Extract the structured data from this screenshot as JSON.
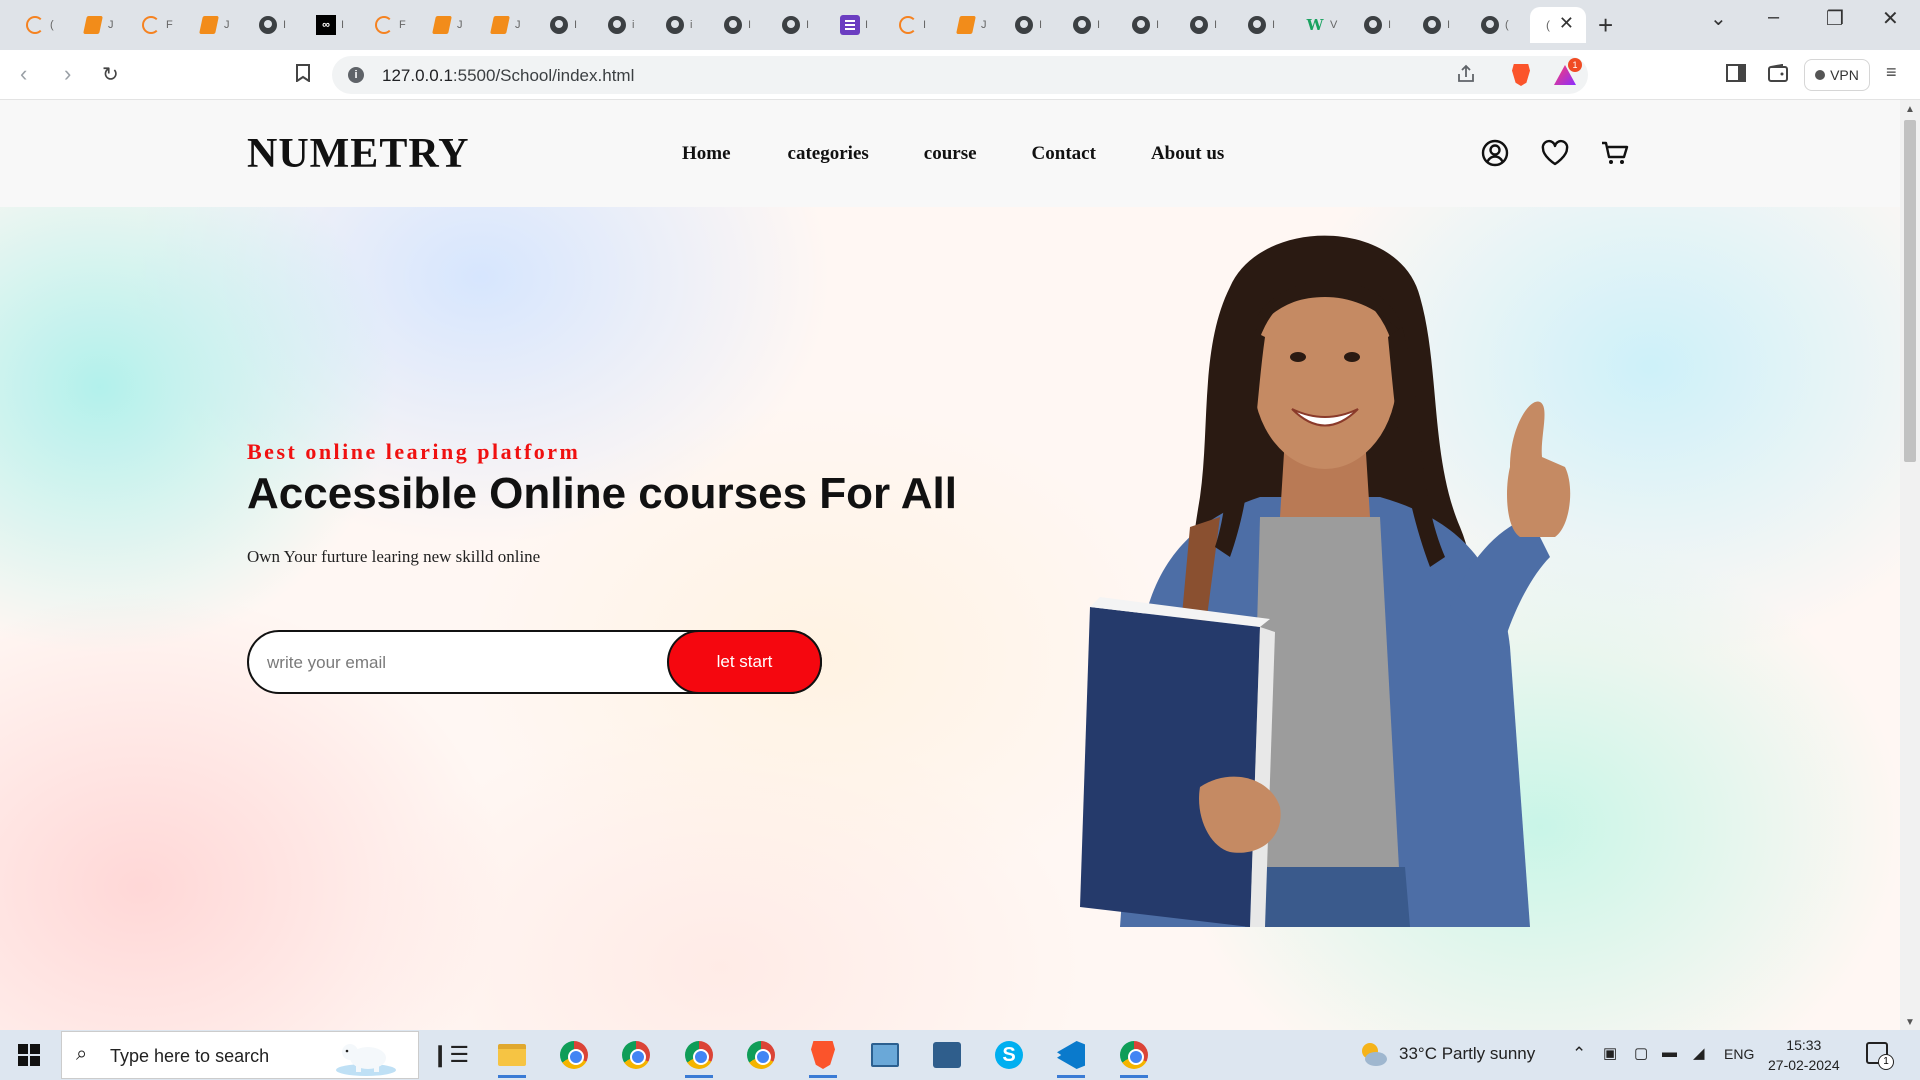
{
  "browser": {
    "tabs": [
      {
        "icon": "ring-favicon-icon",
        "label": "("
      },
      {
        "icon": "book-favicon-icon",
        "label": "J"
      },
      {
        "icon": "ring-favicon-icon",
        "label": "F"
      },
      {
        "icon": "book-favicon-icon",
        "label": "J"
      },
      {
        "icon": "globe-favicon-icon",
        "label": "I"
      },
      {
        "icon": "dark-favicon-icon",
        "label": "I"
      },
      {
        "icon": "ring-favicon-icon",
        "label": "F"
      },
      {
        "icon": "book-favicon-icon",
        "label": "J"
      },
      {
        "icon": "book-favicon-icon",
        "label": "J"
      },
      {
        "icon": "globe-favicon-icon",
        "label": "I"
      },
      {
        "icon": "globe-favicon-icon",
        "label": "i"
      },
      {
        "icon": "globe-favicon-icon",
        "label": "i"
      },
      {
        "icon": "globe-favicon-icon",
        "label": "I"
      },
      {
        "icon": "globe-favicon-icon",
        "label": "I"
      },
      {
        "icon": "purple-favicon-icon",
        "label": "I"
      },
      {
        "icon": "ring-favicon-icon",
        "label": "I"
      },
      {
        "icon": "book-favicon-icon",
        "label": "J"
      },
      {
        "icon": "globe-favicon-icon",
        "label": "I"
      },
      {
        "icon": "globe-favicon-icon",
        "label": "I"
      },
      {
        "icon": "globe-favicon-icon",
        "label": "I"
      },
      {
        "icon": "globe-favicon-icon",
        "label": "I"
      },
      {
        "icon": "globe-favicon-icon",
        "label": "I"
      },
      {
        "icon": "w-favicon-icon",
        "label": "V"
      },
      {
        "icon": "globe-favicon-icon",
        "label": "I"
      },
      {
        "icon": "globe-favicon-icon",
        "label": "I"
      },
      {
        "icon": "globe-favicon-icon",
        "label": "("
      }
    ],
    "active_tab_label": "(",
    "url_host": "127.0.0.1",
    "url_path": ":5500/School/index.html",
    "brave_badge": "1",
    "vpn_label": "VPN"
  },
  "site": {
    "logo": "NUMETRY",
    "nav": [
      "Home",
      "categories",
      "course",
      "Contact",
      "About us"
    ],
    "hero": {
      "eyebrow": "Best online learing platform",
      "headline": "Accessible Online courses For All",
      "subline": "Own Your furture learing new skilld online",
      "email_placeholder": "write your email",
      "cta_label": "let start"
    }
  },
  "taskbar": {
    "search_placeholder": "Type here to search",
    "weather": "33°C  Partly sunny",
    "language": "ENG",
    "time": "15:33",
    "date": "27-02-2024",
    "notification_count": "1"
  }
}
